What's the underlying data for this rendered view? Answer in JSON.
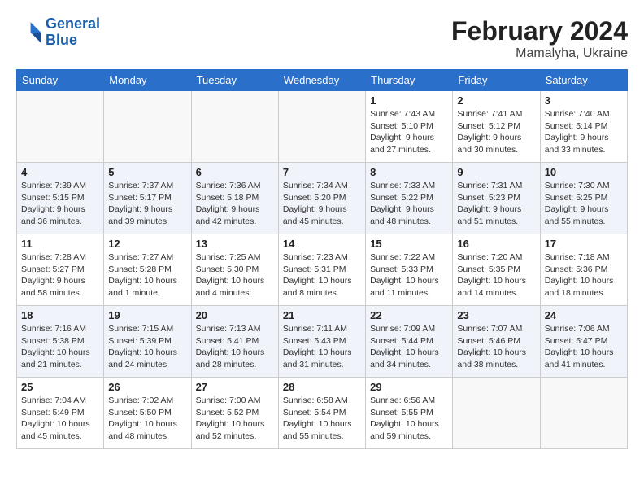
{
  "header": {
    "logo_line1": "General",
    "logo_line2": "Blue",
    "month": "February 2024",
    "location": "Mamalyha, Ukraine"
  },
  "days_of_week": [
    "Sunday",
    "Monday",
    "Tuesday",
    "Wednesday",
    "Thursday",
    "Friday",
    "Saturday"
  ],
  "weeks": [
    [
      {
        "day": "",
        "detail": ""
      },
      {
        "day": "",
        "detail": ""
      },
      {
        "day": "",
        "detail": ""
      },
      {
        "day": "",
        "detail": ""
      },
      {
        "day": "1",
        "detail": "Sunrise: 7:43 AM\nSunset: 5:10 PM\nDaylight: 9 hours\nand 27 minutes."
      },
      {
        "day": "2",
        "detail": "Sunrise: 7:41 AM\nSunset: 5:12 PM\nDaylight: 9 hours\nand 30 minutes."
      },
      {
        "day": "3",
        "detail": "Sunrise: 7:40 AM\nSunset: 5:14 PM\nDaylight: 9 hours\nand 33 minutes."
      }
    ],
    [
      {
        "day": "4",
        "detail": "Sunrise: 7:39 AM\nSunset: 5:15 PM\nDaylight: 9 hours\nand 36 minutes."
      },
      {
        "day": "5",
        "detail": "Sunrise: 7:37 AM\nSunset: 5:17 PM\nDaylight: 9 hours\nand 39 minutes."
      },
      {
        "day": "6",
        "detail": "Sunrise: 7:36 AM\nSunset: 5:18 PM\nDaylight: 9 hours\nand 42 minutes."
      },
      {
        "day": "7",
        "detail": "Sunrise: 7:34 AM\nSunset: 5:20 PM\nDaylight: 9 hours\nand 45 minutes."
      },
      {
        "day": "8",
        "detail": "Sunrise: 7:33 AM\nSunset: 5:22 PM\nDaylight: 9 hours\nand 48 minutes."
      },
      {
        "day": "9",
        "detail": "Sunrise: 7:31 AM\nSunset: 5:23 PM\nDaylight: 9 hours\nand 51 minutes."
      },
      {
        "day": "10",
        "detail": "Sunrise: 7:30 AM\nSunset: 5:25 PM\nDaylight: 9 hours\nand 55 minutes."
      }
    ],
    [
      {
        "day": "11",
        "detail": "Sunrise: 7:28 AM\nSunset: 5:27 PM\nDaylight: 9 hours\nand 58 minutes."
      },
      {
        "day": "12",
        "detail": "Sunrise: 7:27 AM\nSunset: 5:28 PM\nDaylight: 10 hours\nand 1 minute."
      },
      {
        "day": "13",
        "detail": "Sunrise: 7:25 AM\nSunset: 5:30 PM\nDaylight: 10 hours\nand 4 minutes."
      },
      {
        "day": "14",
        "detail": "Sunrise: 7:23 AM\nSunset: 5:31 PM\nDaylight: 10 hours\nand 8 minutes."
      },
      {
        "day": "15",
        "detail": "Sunrise: 7:22 AM\nSunset: 5:33 PM\nDaylight: 10 hours\nand 11 minutes."
      },
      {
        "day": "16",
        "detail": "Sunrise: 7:20 AM\nSunset: 5:35 PM\nDaylight: 10 hours\nand 14 minutes."
      },
      {
        "day": "17",
        "detail": "Sunrise: 7:18 AM\nSunset: 5:36 PM\nDaylight: 10 hours\nand 18 minutes."
      }
    ],
    [
      {
        "day": "18",
        "detail": "Sunrise: 7:16 AM\nSunset: 5:38 PM\nDaylight: 10 hours\nand 21 minutes."
      },
      {
        "day": "19",
        "detail": "Sunrise: 7:15 AM\nSunset: 5:39 PM\nDaylight: 10 hours\nand 24 minutes."
      },
      {
        "day": "20",
        "detail": "Sunrise: 7:13 AM\nSunset: 5:41 PM\nDaylight: 10 hours\nand 28 minutes."
      },
      {
        "day": "21",
        "detail": "Sunrise: 7:11 AM\nSunset: 5:43 PM\nDaylight: 10 hours\nand 31 minutes."
      },
      {
        "day": "22",
        "detail": "Sunrise: 7:09 AM\nSunset: 5:44 PM\nDaylight: 10 hours\nand 34 minutes."
      },
      {
        "day": "23",
        "detail": "Sunrise: 7:07 AM\nSunset: 5:46 PM\nDaylight: 10 hours\nand 38 minutes."
      },
      {
        "day": "24",
        "detail": "Sunrise: 7:06 AM\nSunset: 5:47 PM\nDaylight: 10 hours\nand 41 minutes."
      }
    ],
    [
      {
        "day": "25",
        "detail": "Sunrise: 7:04 AM\nSunset: 5:49 PM\nDaylight: 10 hours\nand 45 minutes."
      },
      {
        "day": "26",
        "detail": "Sunrise: 7:02 AM\nSunset: 5:50 PM\nDaylight: 10 hours\nand 48 minutes."
      },
      {
        "day": "27",
        "detail": "Sunrise: 7:00 AM\nSunset: 5:52 PM\nDaylight: 10 hours\nand 52 minutes."
      },
      {
        "day": "28",
        "detail": "Sunrise: 6:58 AM\nSunset: 5:54 PM\nDaylight: 10 hours\nand 55 minutes."
      },
      {
        "day": "29",
        "detail": "Sunrise: 6:56 AM\nSunset: 5:55 PM\nDaylight: 10 hours\nand 59 minutes."
      },
      {
        "day": "",
        "detail": ""
      },
      {
        "day": "",
        "detail": ""
      }
    ]
  ]
}
